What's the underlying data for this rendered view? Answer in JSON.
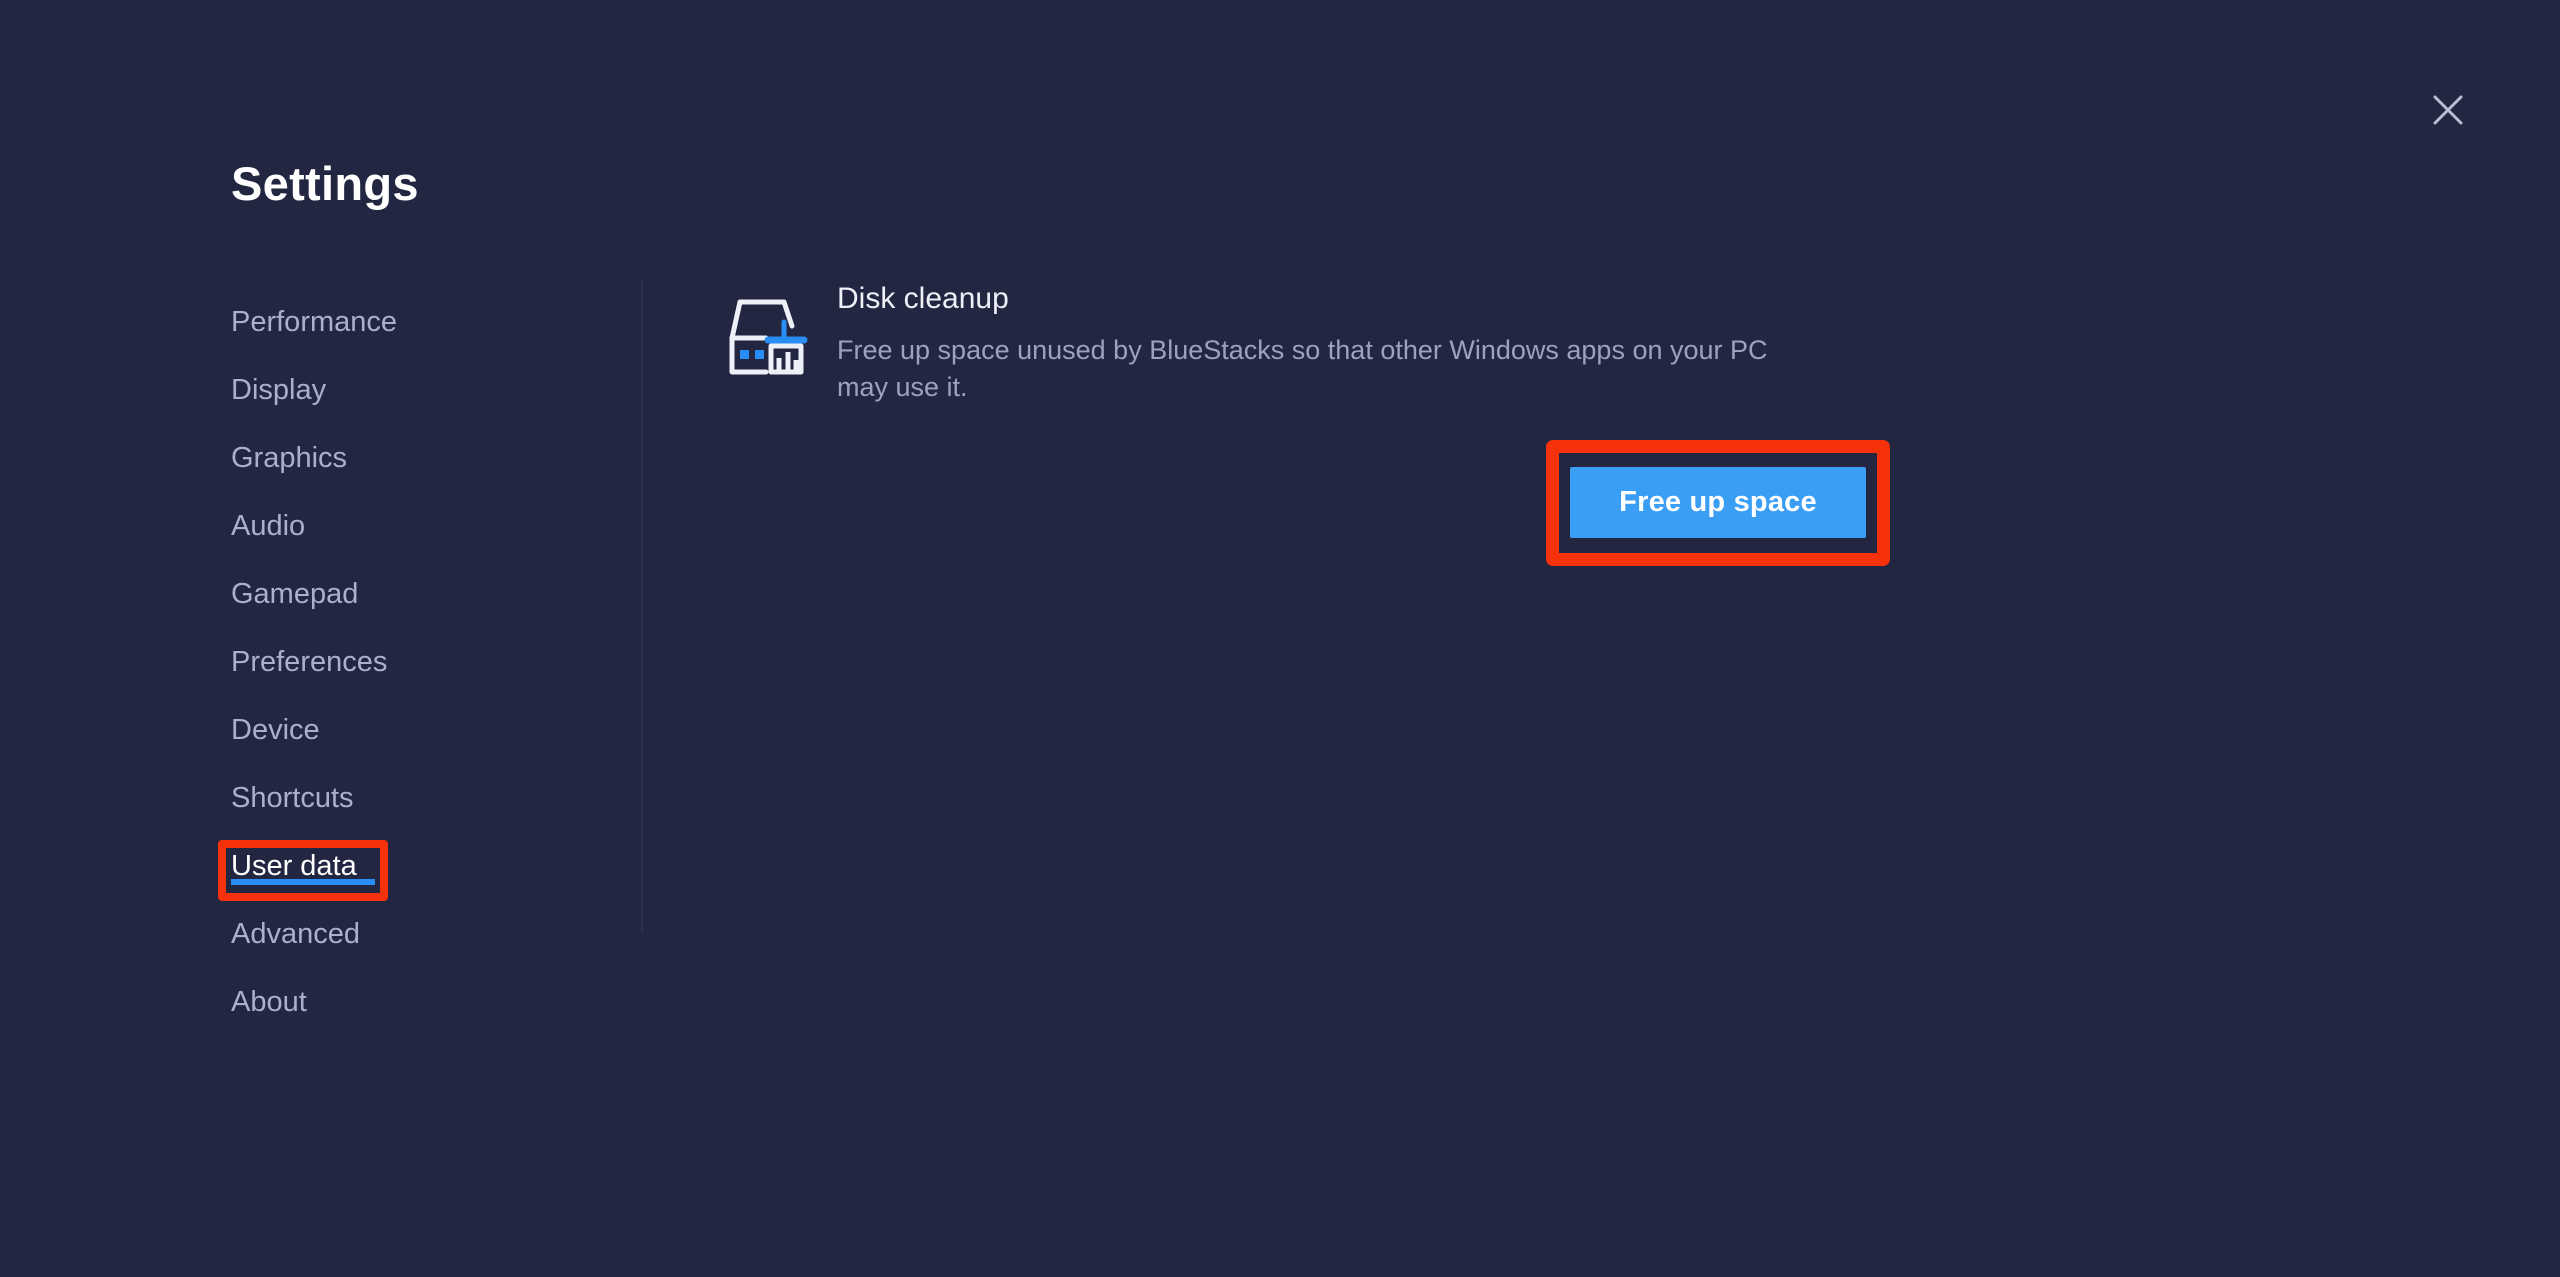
{
  "window": {
    "title": "Settings",
    "close_icon": "close-icon"
  },
  "sidebar": {
    "items": [
      {
        "label": "Performance",
        "active": false
      },
      {
        "label": "Display",
        "active": false
      },
      {
        "label": "Graphics",
        "active": false
      },
      {
        "label": "Audio",
        "active": false
      },
      {
        "label": "Gamepad",
        "active": false
      },
      {
        "label": "Preferences",
        "active": false
      },
      {
        "label": "Device",
        "active": false
      },
      {
        "label": "Shortcuts",
        "active": false
      },
      {
        "label": "User data",
        "active": true
      },
      {
        "label": "Advanced",
        "active": false
      },
      {
        "label": "About",
        "active": false
      }
    ]
  },
  "main": {
    "section": {
      "icon": "disk-cleanup-icon",
      "title": "Disk cleanup",
      "description": "Free up space unused by BlueStacks so that other Windows apps on your PC may use it.",
      "action_label": "Free up space"
    }
  },
  "colors": {
    "background": "#222640",
    "accent_blue": "#3a9ef5",
    "active_underline": "#2a8cf5",
    "annotation_red": "#f5320a",
    "text_primary": "#ffffff",
    "text_muted": "#9aa2c0",
    "sidebar_text": "#aab0cb"
  }
}
